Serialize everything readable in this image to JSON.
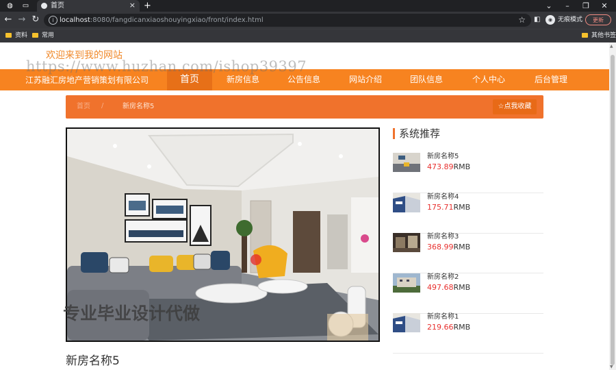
{
  "browser": {
    "tab_title": "首页",
    "url_host": "localhost",
    "url_rest": ":8080/fangdicanxiaoshouyingxiao/front/index.html",
    "incognito_label": "无痕模式",
    "update_label": "更新",
    "bookmarks": [
      "资料",
      "常用"
    ],
    "other_bookmarks": "其他书签"
  },
  "header": {
    "welcome": "欢迎来到我的网站",
    "watermark": "https://www.huzhan.com/ishop39397",
    "company": "江苏融汇房地产营销策划有限公司",
    "nav": [
      "首页",
      "新房信息",
      "公告信息",
      "网站介绍",
      "团队信息",
      "个人中心",
      "后台管理"
    ]
  },
  "breadcrumb": {
    "home": "首页",
    "sep": "/",
    "current": "新房名称5",
    "favorite_label": "☆点我收藏"
  },
  "detail": {
    "image_watermark": "专业毕业设计代做",
    "title": "新房名称5"
  },
  "recommend": {
    "title": "系统推荐",
    "unit": "RMB",
    "items": [
      {
        "name": "新房名称5",
        "price": "473.89"
      },
      {
        "name": "新房名称4",
        "price": "175.71"
      },
      {
        "name": "新房名称3",
        "price": "368.99"
      },
      {
        "name": "新房名称2",
        "price": "497.68"
      },
      {
        "name": "新房名称1",
        "price": "219.66"
      }
    ]
  },
  "colors": {
    "nav_orange": "#f78320",
    "breadcrumb_orange": "#f0722c",
    "price_red": "#e8302e"
  }
}
